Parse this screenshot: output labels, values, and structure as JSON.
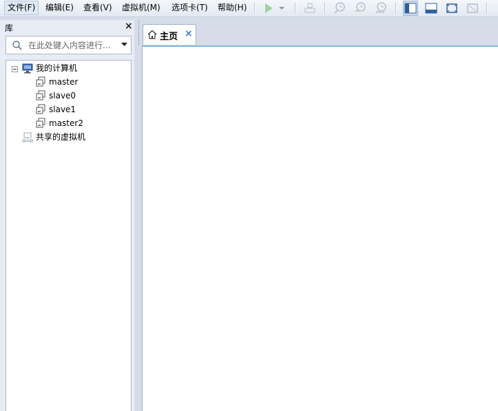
{
  "menu": {
    "file": "文件(F)",
    "edit": "编辑(E)",
    "view": "查看(V)",
    "vm": "虚拟机(M)",
    "tabs": "选项卡(T)",
    "help": "帮助(H)"
  },
  "toolbar": {
    "icons": [
      "play-icon",
      "dropdown-arrow-icon",
      "send-keys-icon",
      "snapshot-icon",
      "revert-snapshot-icon",
      "manage-snapshots-icon",
      "library-view-icon",
      "console-view-icon",
      "fullscreen-icon",
      "unity-icon"
    ]
  },
  "library": {
    "title": "库",
    "close": "×",
    "search_placeholder": "在此处键入内容进行...",
    "tree": {
      "root_label": "我的计算机",
      "vms": [
        "master",
        "slave0",
        "slave1",
        "master2"
      ],
      "shared_label": "共享的虚拟机"
    }
  },
  "tabs": {
    "home_label": "主页",
    "close": "×"
  },
  "colors": {
    "accent": "#3a7bd5",
    "pane_bg": "#e8edf5",
    "frame_bg": "#d6dde9"
  }
}
